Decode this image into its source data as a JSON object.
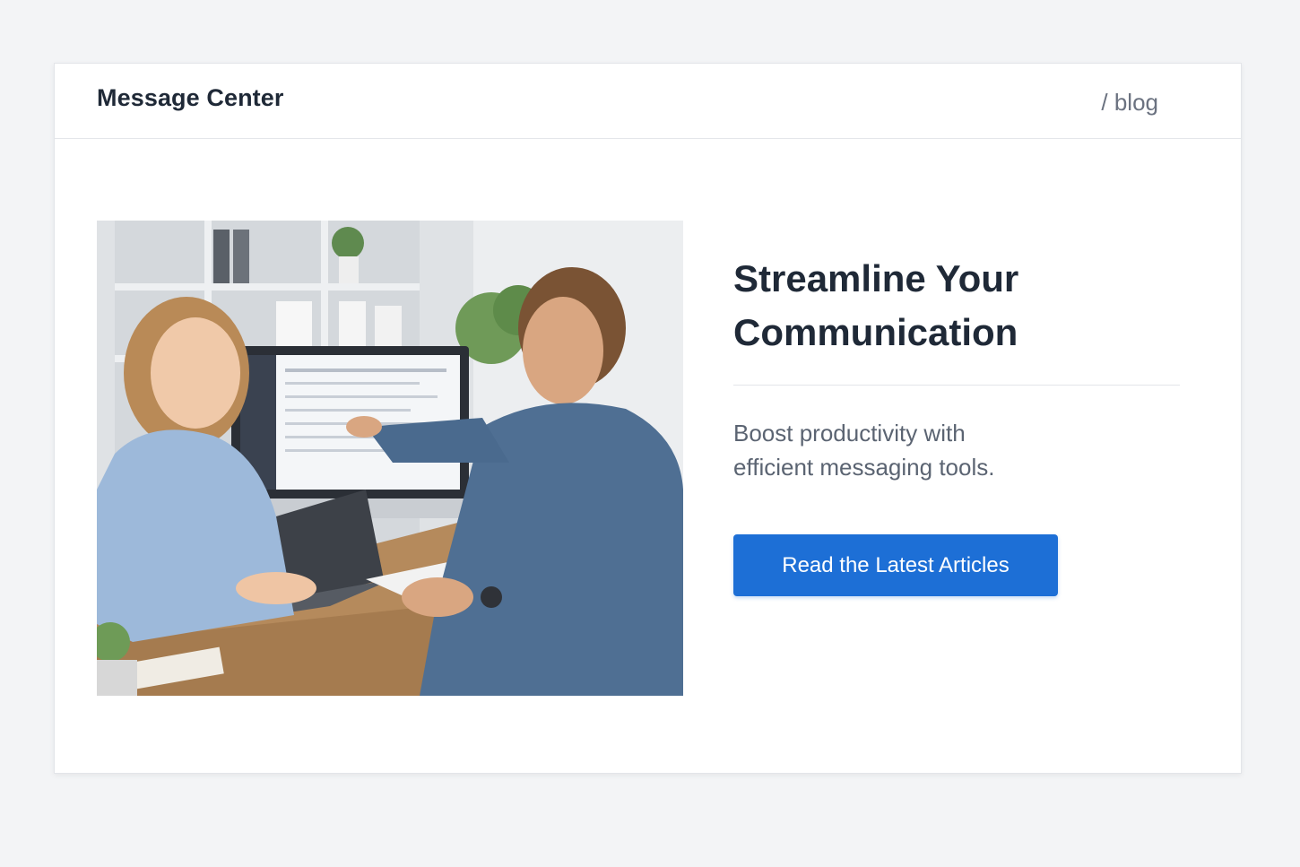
{
  "header": {
    "app_title": "Message Center",
    "breadcrumb": "/ blog"
  },
  "hero": {
    "image_icon": "office-photo-icon",
    "headline": "Streamline Your Communication",
    "subtext": "Boost productivity with efficient messaging tools.",
    "cta_label": "Read the Latest Articles"
  },
  "colors": {
    "background": "#f3f4f6",
    "card": "#ffffff",
    "text_primary": "#1f2937",
    "text_secondary": "#5b6472",
    "accent": "#1d6fd6"
  }
}
